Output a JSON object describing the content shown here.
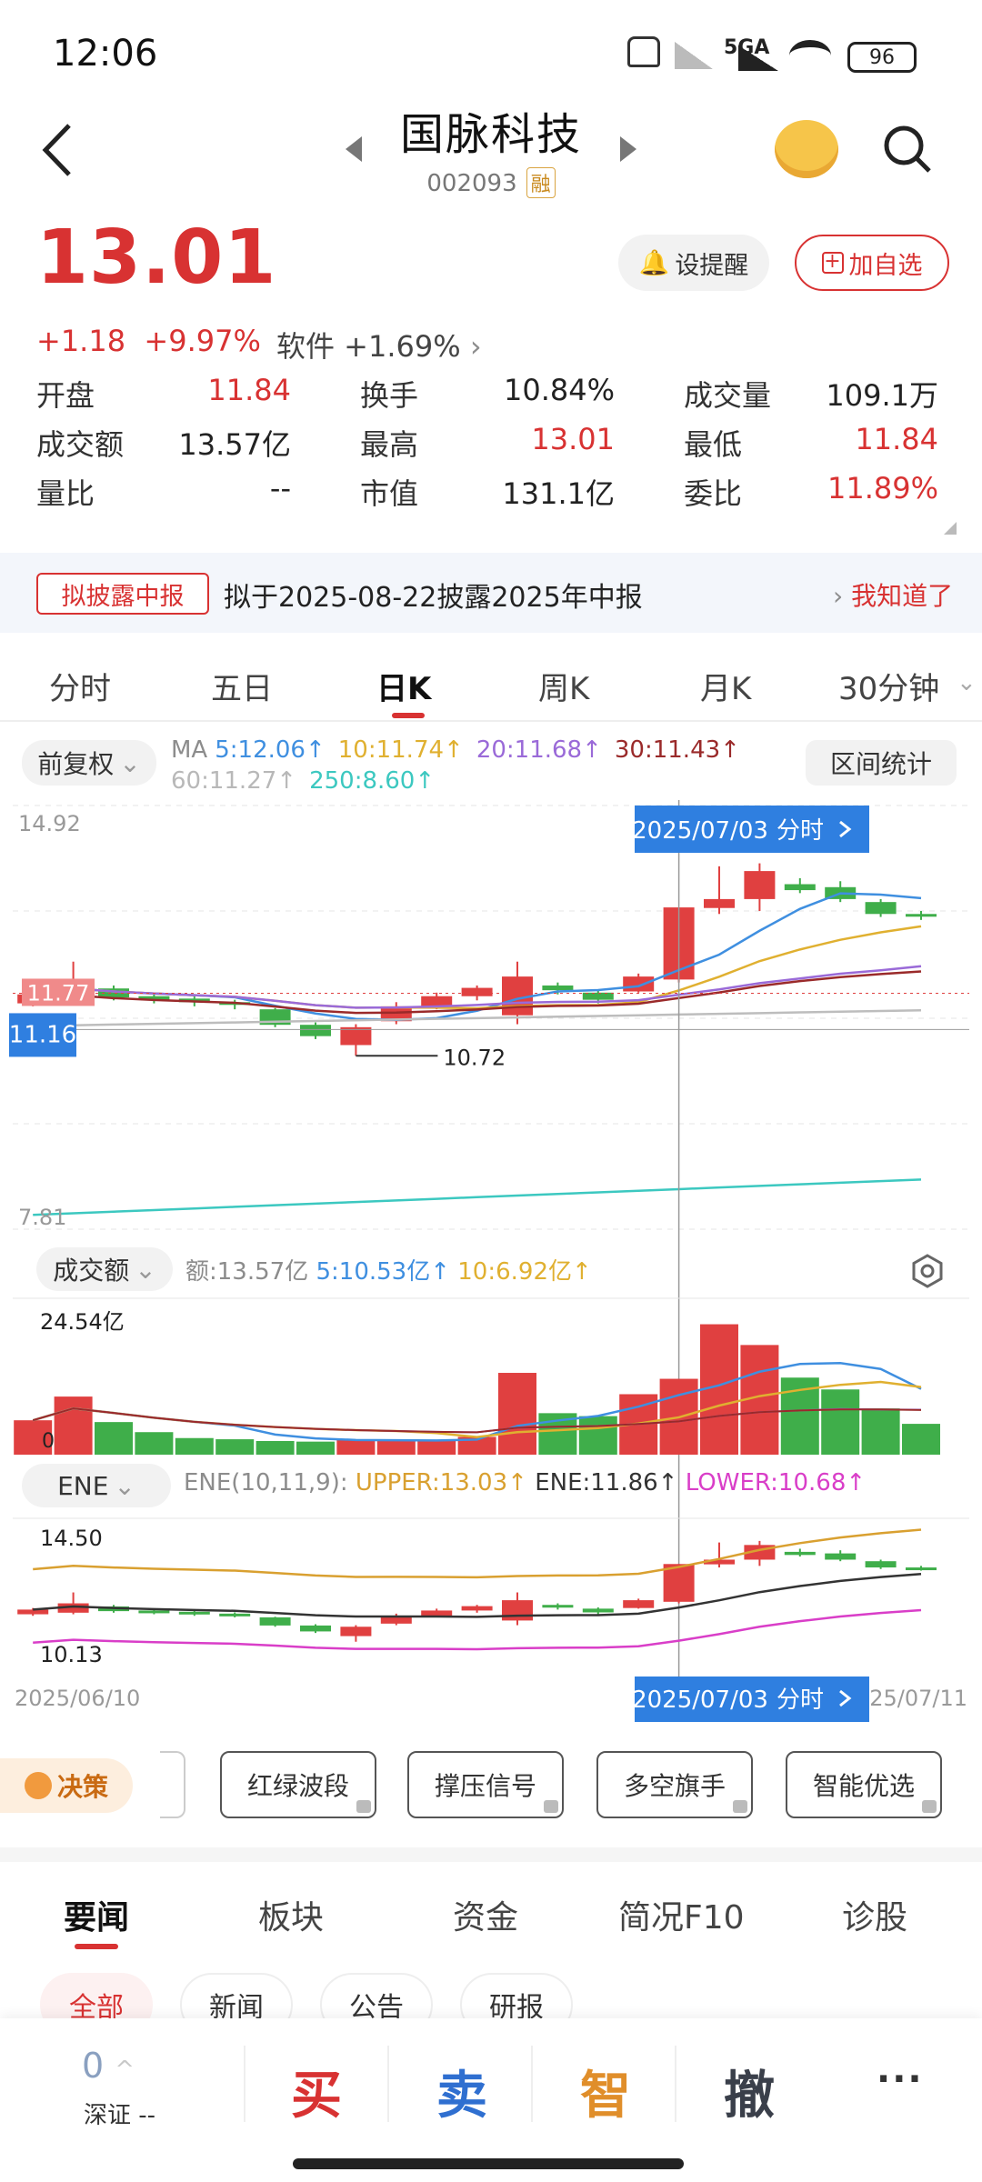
{
  "status": {
    "time": "12:06",
    "network": "5GA",
    "battery": "96"
  },
  "header": {
    "title": "国脉科技",
    "code": "002093",
    "margin_tag": "融"
  },
  "quote": {
    "price": "13.01",
    "change": "+1.18",
    "change_pct": "+9.97%",
    "sector": "软件 +1.69%",
    "alert_btn": "设提醒",
    "fav_btn": "加自选",
    "stats": [
      {
        "label": "开盘",
        "value": "11.84",
        "red": true
      },
      {
        "label": "换手",
        "value": "10.84%",
        "red": false
      },
      {
        "label": "成交量",
        "value": "109.1万",
        "red": false
      },
      {
        "label": "成交额",
        "value": "13.57亿",
        "red": false
      },
      {
        "label": "最高",
        "value": "13.01",
        "red": true
      },
      {
        "label": "最低",
        "value": "11.84",
        "red": true
      },
      {
        "label": "量比",
        "value": "--",
        "red": false
      },
      {
        "label": "市值",
        "value": "131.1亿",
        "red": false
      },
      {
        "label": "委比",
        "value": "11.89%",
        "red": true
      }
    ]
  },
  "notice": {
    "tag": "拟披露中报",
    "text": "拟于2025-08-22披露2025年中报",
    "action": "我知道了"
  },
  "chart_tabs": [
    "分时",
    "五日",
    "日K",
    "周K",
    "月K",
    "30分钟"
  ],
  "active_tab": 2,
  "kline": {
    "adjust": "前复权",
    "ma_label": "MA",
    "ma": [
      {
        "text": "5:12.06↑",
        "color": "#3f8fe0"
      },
      {
        "text": "10:11.74↑",
        "color": "#e0b030"
      },
      {
        "text": "20:11.68↑",
        "color": "#9a6ad8"
      },
      {
        "text": "30:11.43↑",
        "color": "#9a2a2a"
      },
      {
        "text": "60:11.27↑",
        "color": "#b8b8b8"
      },
      {
        "text": "250:8.60↑",
        "color": "#3cc8c0"
      }
    ],
    "range_btn": "区间统计",
    "y_top": "14.92",
    "y_bottom": "7.81",
    "cursor_date": "2025/07/03",
    "cursor_action": "分时",
    "price_tag_red": "11.77",
    "price_tag_blue": "11.16",
    "low_annotation": "10.72"
  },
  "volume": {
    "label": "成交额",
    "amount": "额:13.57亿",
    "ma5": "5:10.53亿↑",
    "ma10": "10:6.92亿↑",
    "y_top": "24.54亿",
    "y_zero": "0"
  },
  "ene": {
    "label": "ENE",
    "params": "ENE(10,11,9):",
    "upper": "UPPER:13.03↑",
    "mid": "ENE:11.86↑",
    "lower": "LOWER:10.68↑",
    "y_top": "14.50",
    "y_bottom": "10.13",
    "date_start": "2025/06/10",
    "date_end": "25/07/11"
  },
  "chart_data": {
    "type": "candlestick",
    "title": "",
    "dates_visible": [
      "2025/06/10",
      "2025/07/03",
      "25/07/11"
    ],
    "ylim": [
      7.81,
      14.92
    ],
    "candles": [
      {
        "o": 11.6,
        "c": 11.75,
        "h": 11.8,
        "l": 11.55
      },
      {
        "o": 11.65,
        "c": 11.95,
        "h": 12.3,
        "l": 11.6
      },
      {
        "o": 11.85,
        "c": 11.7,
        "h": 11.9,
        "l": 11.65
      },
      {
        "o": 11.72,
        "c": 11.66,
        "h": 11.78,
        "l": 11.6
      },
      {
        "o": 11.68,
        "c": 11.62,
        "h": 11.72,
        "l": 11.55
      },
      {
        "o": 11.62,
        "c": 11.58,
        "h": 11.66,
        "l": 11.5
      },
      {
        "o": 11.5,
        "c": 11.24,
        "h": 11.52,
        "l": 11.2
      },
      {
        "o": 11.24,
        "c": 11.05,
        "h": 11.28,
        "l": 11.0
      },
      {
        "o": 10.9,
        "c": 11.2,
        "h": 11.25,
        "l": 10.72
      },
      {
        "o": 11.3,
        "c": 11.55,
        "h": 11.62,
        "l": 11.25
      },
      {
        "o": 11.55,
        "c": 11.72,
        "h": 11.78,
        "l": 11.5
      },
      {
        "o": 11.72,
        "c": 11.86,
        "h": 11.9,
        "l": 11.65
      },
      {
        "o": 11.4,
        "c": 12.05,
        "h": 12.3,
        "l": 11.25
      },
      {
        "o": 11.9,
        "c": 11.82,
        "h": 11.95,
        "l": 11.75
      },
      {
        "o": 11.78,
        "c": 11.66,
        "h": 11.82,
        "l": 11.6
      },
      {
        "o": 11.8,
        "c": 12.05,
        "h": 12.1,
        "l": 11.78
      },
      {
        "o": 12.0,
        "c": 13.21,
        "h": 13.21,
        "l": 11.95
      },
      {
        "o": 13.2,
        "c": 13.35,
        "h": 13.9,
        "l": 13.1
      },
      {
        "o": 13.35,
        "c": 13.82,
        "h": 13.95,
        "l": 13.15
      },
      {
        "o": 13.6,
        "c": 13.5,
        "h": 13.7,
        "l": 13.45
      },
      {
        "o": 13.55,
        "c": 13.35,
        "h": 13.65,
        "l": 13.3
      },
      {
        "o": 13.3,
        "c": 13.1,
        "h": 13.35,
        "l": 13.05
      },
      {
        "o": 13.1,
        "c": 13.06,
        "h": 13.15,
        "l": 13.0
      }
    ],
    "volume_ylim": [
      0,
      24.54
    ],
    "volume": [
      5.8,
      9.8,
      5.5,
      3.8,
      2.8,
      2.6,
      2.3,
      2.2,
      2.5,
      2.6,
      2.4,
      3.0,
      13.8,
      7.0,
      6.5,
      10.2,
      12.8,
      22.0,
      18.5,
      13.0,
      11.0,
      7.8,
      5.2
    ]
  },
  "tools": {
    "badge": "决策",
    "items": [
      "红绿波段",
      "撑压信号",
      "多空旗手",
      "智能优选"
    ]
  },
  "news_tabs": [
    "要闻",
    "板块",
    "资金",
    "简况F10",
    "诊股"
  ],
  "news_chips": [
    "全部",
    "新闻",
    "公告",
    "研报"
  ],
  "bottom_bar": {
    "count": "0",
    "market": "深证 --",
    "buy": "买",
    "sell": "卖",
    "smart": "智",
    "cancel": "撤",
    "more": "···"
  }
}
